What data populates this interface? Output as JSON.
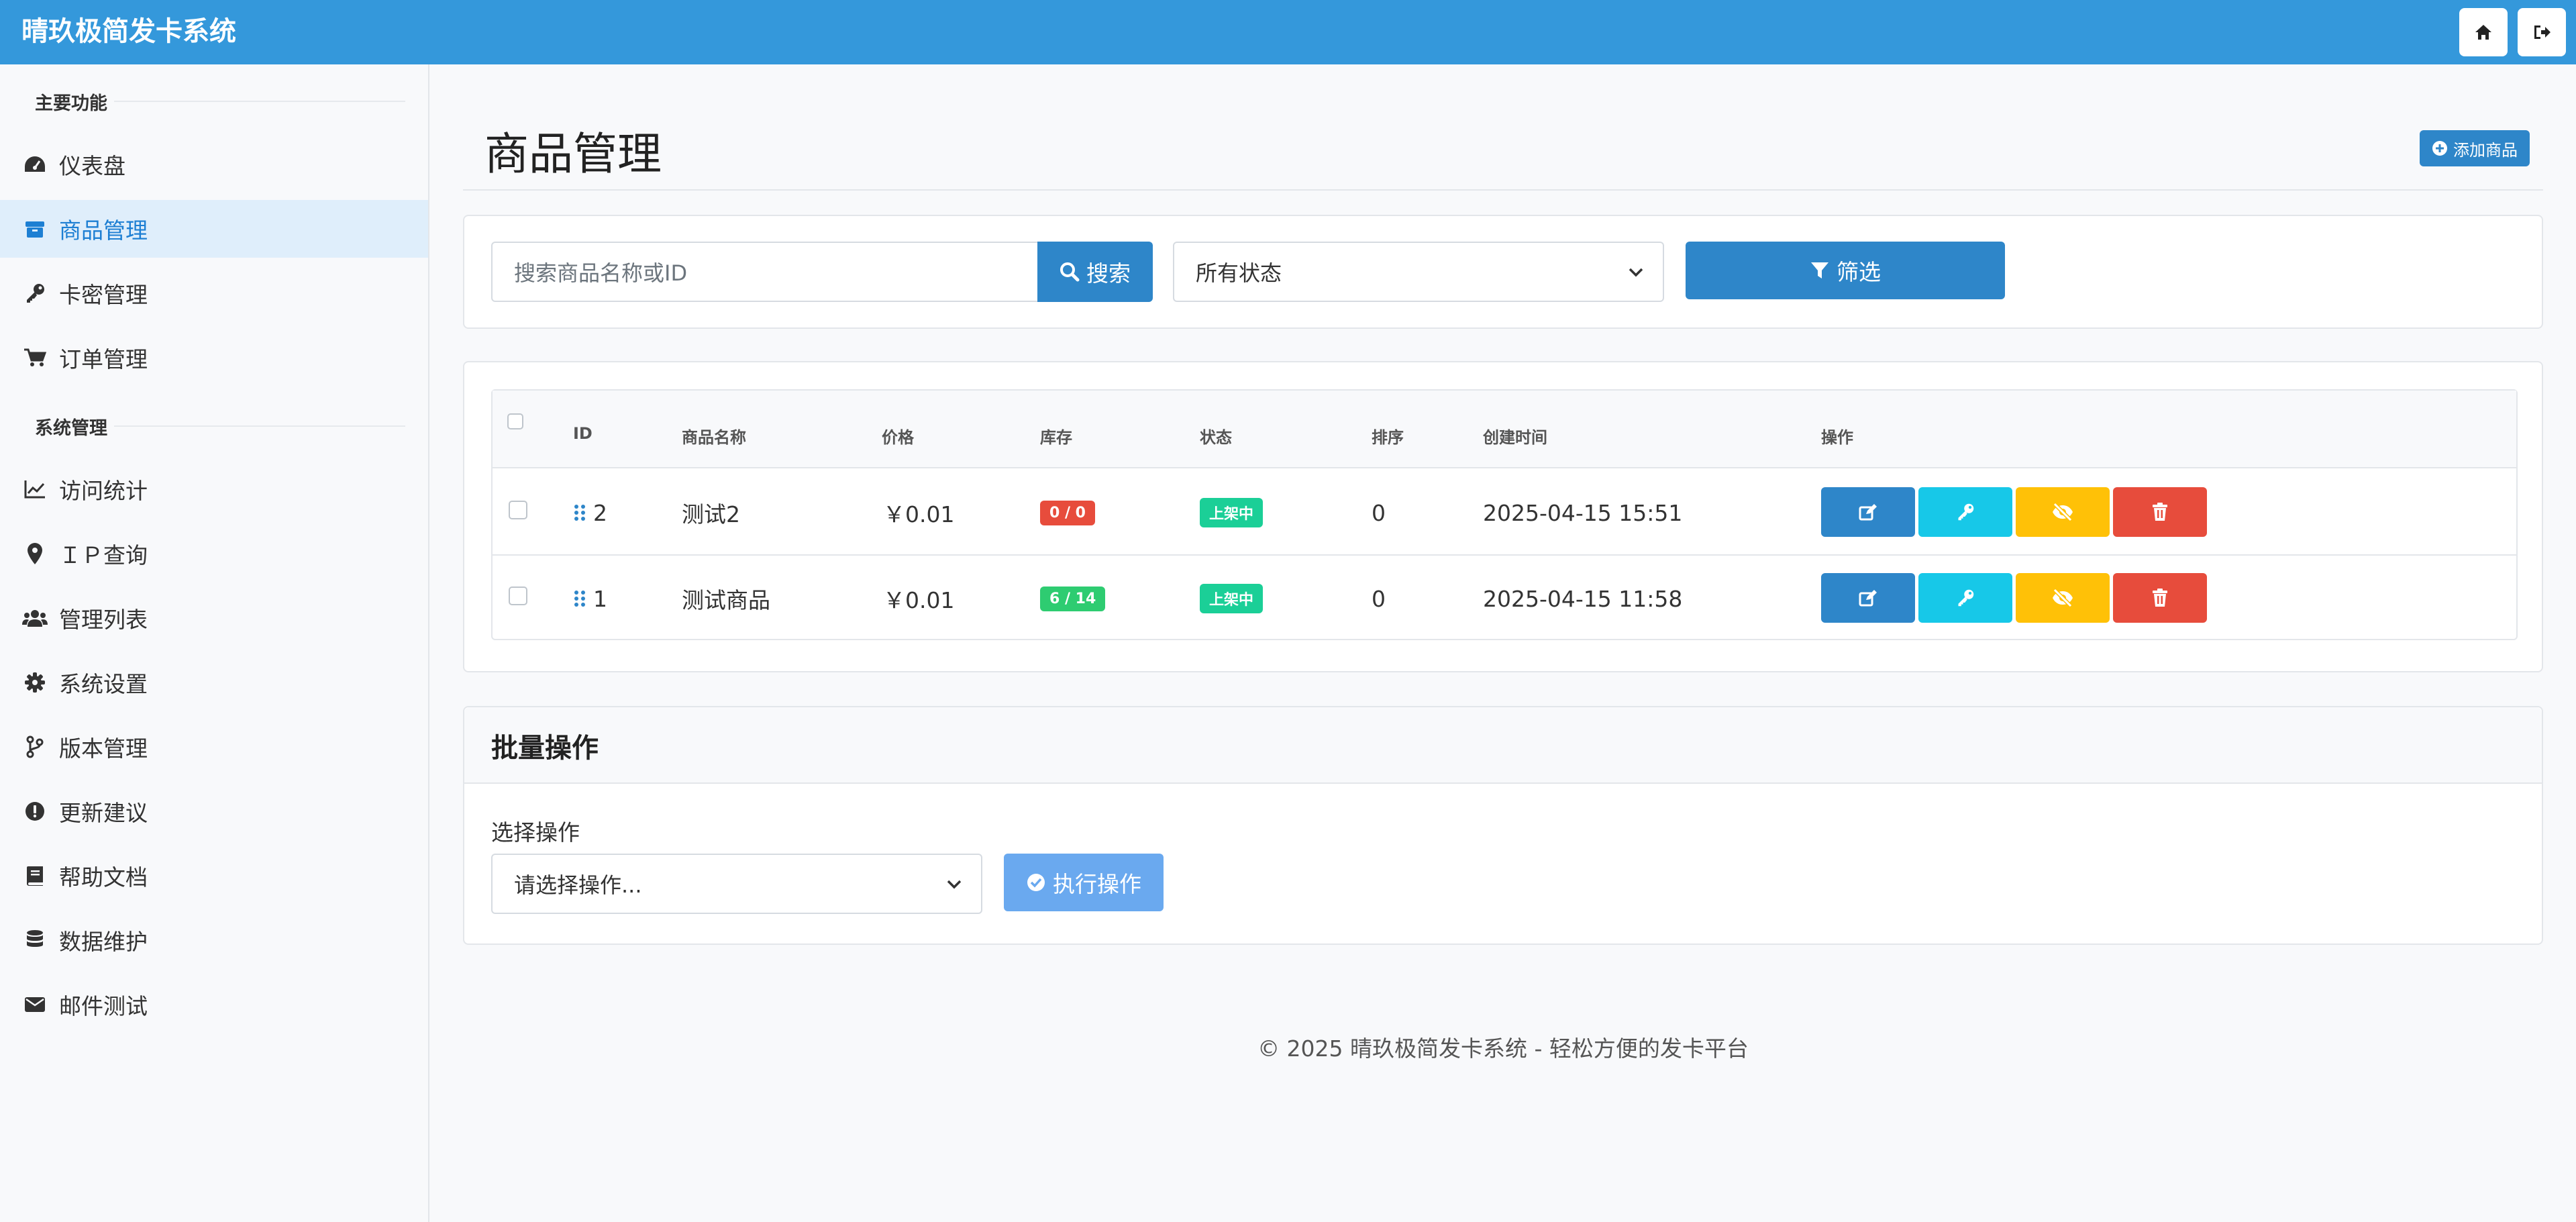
{
  "app": {
    "title": "晴玖极简发卡系统"
  },
  "topbar": {
    "home_icon": "home-icon",
    "logout_icon": "logout-icon"
  },
  "sidebar": {
    "sections": [
      {
        "title": "主要功能",
        "items": [
          {
            "label": "仪表盘",
            "icon": "dashboard-icon"
          },
          {
            "label": "商品管理",
            "icon": "box-icon",
            "active": true
          },
          {
            "label": "卡密管理",
            "icon": "key-icon"
          },
          {
            "label": "订单管理",
            "icon": "cart-icon"
          }
        ]
      },
      {
        "title": "系统管理",
        "items": [
          {
            "label": "访问统计",
            "icon": "chart-line-icon"
          },
          {
            "label": "ＩＰ查询",
            "icon": "map-pin-icon"
          },
          {
            "label": "管理列表",
            "icon": "users-icon"
          },
          {
            "label": "系统设置",
            "icon": "gear-icon"
          },
          {
            "label": "版本管理",
            "icon": "branch-icon"
          },
          {
            "label": "更新建议",
            "icon": "alert-icon"
          },
          {
            "label": "帮助文档",
            "icon": "book-icon"
          },
          {
            "label": "数据维护",
            "icon": "database-icon"
          },
          {
            "label": "邮件测试",
            "icon": "envelope-icon"
          }
        ]
      }
    ]
  },
  "main": {
    "title": "商品管理",
    "add_button": "添加商品",
    "search": {
      "placeholder": "搜索商品名称或ID",
      "button": "搜索"
    },
    "filter": {
      "selected": "所有状态",
      "button": "筛选"
    },
    "table": {
      "headers": [
        "ID",
        "商品名称",
        "价格",
        "库存",
        "状态",
        "排序",
        "创建时间",
        "操作"
      ],
      "rows": [
        {
          "id": "2",
          "name": "测试2",
          "price": "￥0.01",
          "stock": "0 / 0",
          "stock_color": "#e74c3c",
          "status": "上架中",
          "sort": "0",
          "created": "2025-04-15 15:51"
        },
        {
          "id": "1",
          "name": "测试商品",
          "price": "￥0.01",
          "stock": "6 / 14",
          "stock_color": "#2ecc71",
          "status": "上架中",
          "sort": "0",
          "created": "2025-04-15 11:58"
        }
      ]
    },
    "bulk": {
      "title": "批量操作",
      "label": "选择操作",
      "select_placeholder": "请选择操作...",
      "execute": "执行操作"
    },
    "footer": "© 2025 晴玖极简发卡系统 - 轻松方便的发卡平台"
  },
  "colors": {
    "primary": "#3498db",
    "button": "#2e86c9",
    "info": "#17c8e8",
    "warning": "#ffc107",
    "danger": "#e74c3c",
    "success": "#2ecc71",
    "status": "#1bcf97"
  }
}
